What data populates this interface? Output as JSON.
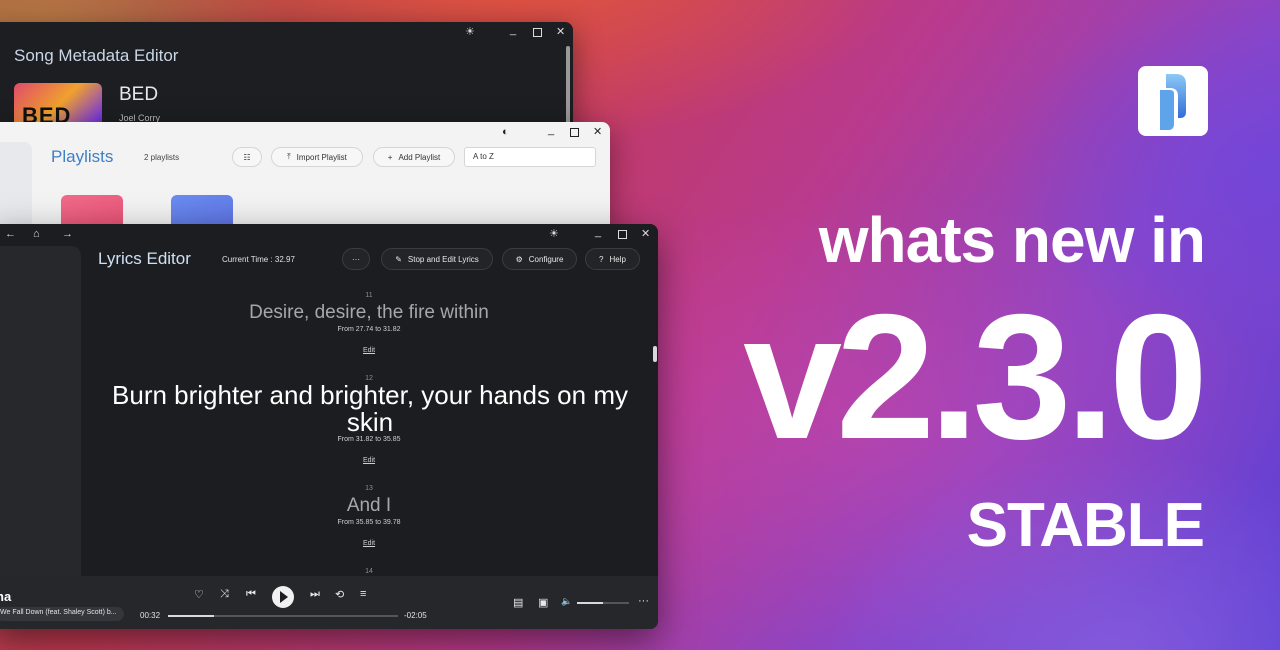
{
  "meta_window": {
    "title": "Song Metadata Editor",
    "song_title": "BED",
    "artist": "Joel Corry",
    "cover_text": "BED"
  },
  "playlists_window": {
    "title": "Playlists",
    "count": "2 playlists",
    "import_label": "Import Playlist",
    "add_label": "Add Playlist",
    "sort_value": "A to Z"
  },
  "lyrics_window": {
    "title": "Lyrics Editor",
    "current_time": "Current Time : 32.97",
    "more_label": "···",
    "stop_edit_label": "Stop and Edit Lyrics",
    "configure_label": "Configure",
    "help_label": "Help",
    "lines": [
      {
        "num": "11",
        "text": "Desire, desire, the fire within",
        "from": "From 27.74 to 31.82",
        "edit": "Edit"
      },
      {
        "num": "12",
        "text": "Burn brighter and brighter, your hands on my skin",
        "from": "From 31.82 to 35.85",
        "edit": "Edit"
      },
      {
        "num": "13",
        "text": "And I",
        "from": "From 35.85 to 39.78",
        "edit": "Edit"
      },
      {
        "num": "14"
      }
    ]
  },
  "player": {
    "song": "na",
    "artist": "We Fall Down (feat. Shaley Scott) b...",
    "elapsed": "00:32",
    "remaining": "-02:05",
    "progress_fraction": 0.2,
    "volume_fraction": 0.5
  },
  "promo": {
    "line1": "whats new in",
    "version": "v2.3.0",
    "tag": "STABLE"
  },
  "colors": {
    "accent_blue": "#3f7fc4",
    "dark_window": "#1c1d20",
    "light_window": "#f3f3f3"
  }
}
